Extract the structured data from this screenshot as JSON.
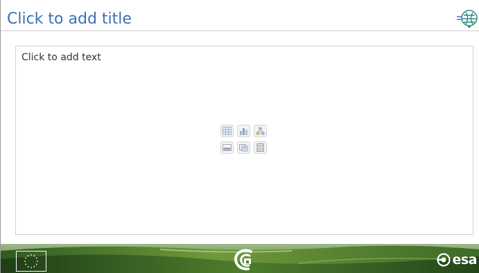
{
  "slide": {
    "title_placeholder": "Click to add title",
    "content_placeholder": "Click to add text"
  },
  "insert_icons": [
    {
      "name": "insert-table-icon"
    },
    {
      "name": "insert-chart-icon"
    },
    {
      "name": "insert-smartart-icon"
    },
    {
      "name": "insert-picture-icon"
    },
    {
      "name": "insert-clipart-icon"
    },
    {
      "name": "insert-media-icon"
    }
  ],
  "footer": {
    "esa_label": "esa"
  },
  "colors": {
    "title": "#3a6fb4",
    "footer_green": "#5f8a2e",
    "footer_dark": "#24451a"
  }
}
